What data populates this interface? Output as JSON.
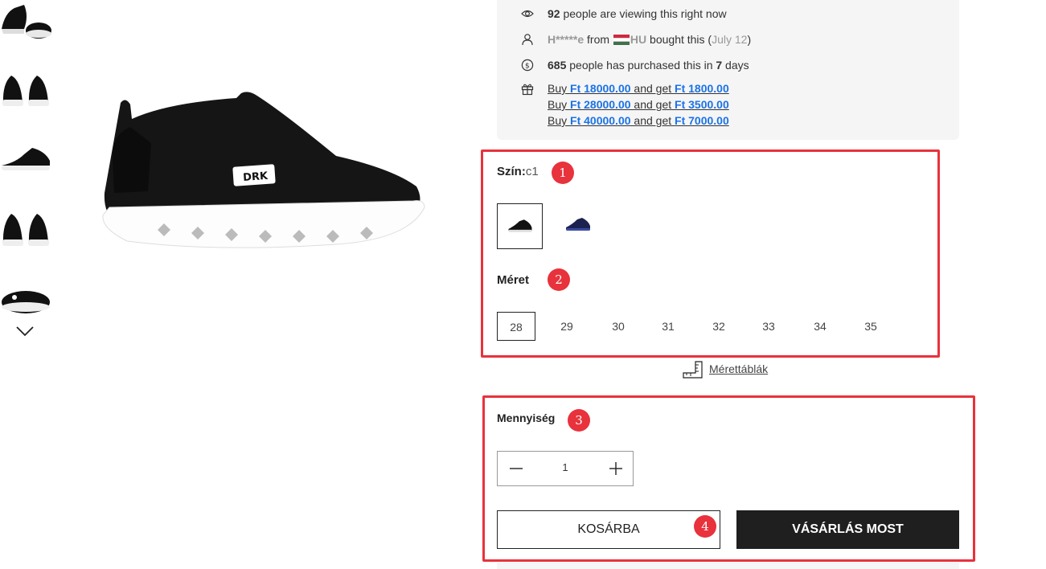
{
  "info": {
    "viewing": {
      "count": "92",
      "text": " people are viewing this right now"
    },
    "bought": {
      "user": "H*****e",
      "from": " from ",
      "country": "HU",
      "text": " bought this (",
      "date": "July 12",
      "close": ")"
    },
    "purchased": {
      "count": "685",
      "text": " people has purchased this in ",
      "days": "7",
      "unit": " days"
    },
    "offers": [
      {
        "buy": "Buy ",
        "threshold": "Ft 18000.00",
        "and": " and get ",
        "reward": "Ft 1800.00"
      },
      {
        "buy": "Buy ",
        "threshold": "Ft 28000.00",
        "and": " and get ",
        "reward": "Ft 3500.00"
      },
      {
        "buy": "Buy ",
        "threshold": "Ft 40000.00",
        "and": " and get ",
        "reward": "Ft 7000.00"
      }
    ]
  },
  "color": {
    "label": "Szín:",
    "value": "c1"
  },
  "size": {
    "label": "Méret",
    "options": [
      "28",
      "29",
      "30",
      "31",
      "32",
      "33",
      "34",
      "35"
    ],
    "selected": "28"
  },
  "size_chart": {
    "label": "Mérettáblák"
  },
  "quantity": {
    "label": "Mennyiség",
    "value": "1"
  },
  "buttons": {
    "cart": "KOSÁRBA",
    "buy": "VÁSÁRLÁS MOST"
  },
  "annotations": [
    "1",
    "2",
    "3",
    "4"
  ],
  "colors": {
    "accent_red": "#e8323c",
    "link_blue": "#1a73e8",
    "dark_button": "#1f1f1f"
  },
  "icons": [
    "eye-icon",
    "user-icon",
    "dollar-coin-icon",
    "gift-icon",
    "ruler-icon",
    "chevron-down-icon",
    "minus-icon",
    "plus-icon"
  ]
}
